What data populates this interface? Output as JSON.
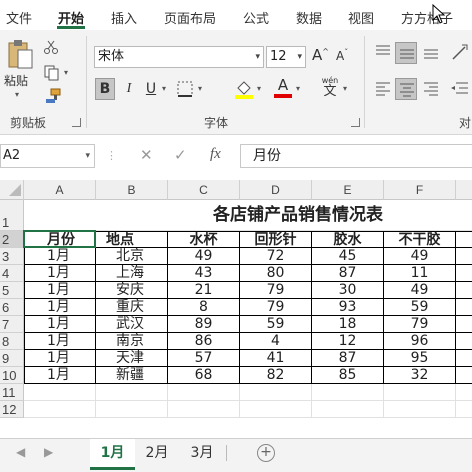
{
  "ribbon_tabs": [
    "文件",
    "开始",
    "插入",
    "页面布局",
    "公式",
    "数据",
    "视图",
    "方方格子"
  ],
  "active_tab": "开始",
  "clipboard": {
    "paste_label": "粘贴",
    "group_label": "剪贴板"
  },
  "font": {
    "group_label": "字体",
    "name": "宋体",
    "size": "12",
    "bold": "B",
    "italic": "I",
    "underline": "U",
    "font_color_glyph": "A",
    "wen_glyph": "wén",
    "wen_char": "文"
  },
  "align_group_label": "对",
  "name_box": "A2",
  "formula_bar_value": "月份",
  "fx_label": "fx",
  "columns": [
    "A",
    "B",
    "C",
    "D",
    "E",
    "F"
  ],
  "rows": [
    "1",
    "2",
    "3",
    "4",
    "5",
    "6",
    "7",
    "8",
    "9",
    "10",
    "11",
    "12"
  ],
  "sheet": {
    "title": "各店铺产品销售情况表",
    "headers": [
      "月份",
      "地点",
      "水杯",
      "回形针",
      "胶水",
      "不干胶"
    ],
    "data": [
      [
        "1月",
        "北京",
        "49",
        "72",
        "45",
        "49"
      ],
      [
        "1月",
        "上海",
        "43",
        "80",
        "87",
        "11"
      ],
      [
        "1月",
        "安庆",
        "21",
        "79",
        "30",
        "49"
      ],
      [
        "1月",
        "重庆",
        "8",
        "79",
        "93",
        "59"
      ],
      [
        "1月",
        "武汉",
        "89",
        "59",
        "18",
        "79"
      ],
      [
        "1月",
        "南京",
        "86",
        "4",
        "12",
        "96"
      ],
      [
        "1月",
        "天津",
        "57",
        "41",
        "87",
        "95"
      ],
      [
        "1月",
        "新疆",
        "68",
        "82",
        "85",
        "32"
      ]
    ]
  },
  "sheet_tabs": [
    "1月",
    "2月",
    "3月"
  ],
  "active_sheet": "1月",
  "add_sheet": "+",
  "colors": {
    "accent": "#217346",
    "selection": "#217346",
    "font_color_bar": "#e00000",
    "highlight_bar": "#ffff00"
  }
}
